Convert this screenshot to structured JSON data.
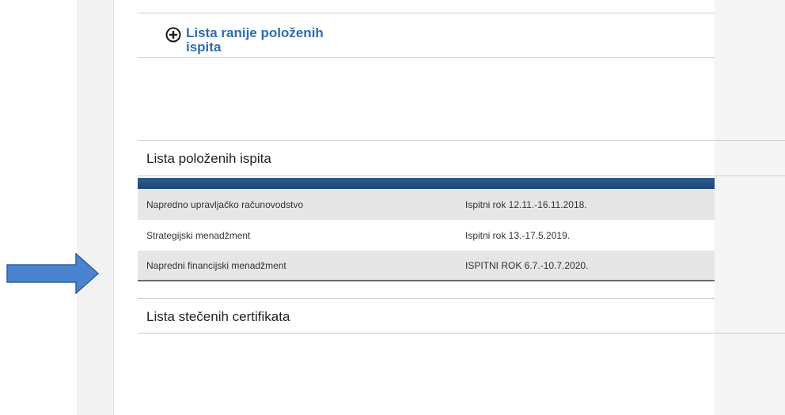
{
  "expand_section": {
    "label": "Lista ranije položenih ispita",
    "icon": "plus-circle-icon"
  },
  "passed_exams": {
    "title": "Lista položenih ispita",
    "rows": [
      {
        "course": "Napredno upravljačko računovodstvo",
        "term": "Ispitni rok 12.11.-16.11.2018."
      },
      {
        "course": "Strategijski menadžment",
        "term": "Ispitni rok 13.-17.5.2019."
      },
      {
        "course": "Napredni financijski menadžment",
        "term": "ISPITNI ROK 6.7.-10.7.2020."
      }
    ]
  },
  "certificates": {
    "title": "Lista stečenih certifikata"
  },
  "colors": {
    "link_blue": "#2e6db5",
    "header_blue": "#1c4677",
    "arrow_blue": "#4a84d0"
  }
}
